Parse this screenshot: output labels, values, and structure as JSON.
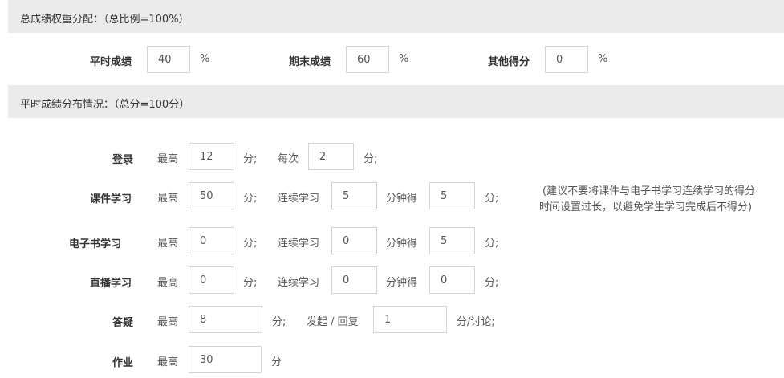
{
  "weights_section": {
    "header": "总成绩权重分配：（总比例=100%）",
    "items": [
      {
        "label": "平时成绩",
        "value": "40",
        "unit": "%"
      },
      {
        "label": "期末成绩",
        "value": "60",
        "unit": "%"
      },
      {
        "label": "其他得分",
        "value": "0",
        "unit": "%"
      }
    ]
  },
  "usual_section": {
    "header": "平时成绩分布情况：（总分=100分）",
    "login": {
      "label": "登录",
      "max_label": "最高",
      "max": "12",
      "unit": "分;",
      "each_label": "每次",
      "each": "2",
      "each_unit": "分;"
    },
    "course": {
      "label": "课件学习",
      "max_label": "最高",
      "max": "50",
      "unit": "分;",
      "cont_label": "连续学习",
      "minutes": "5",
      "min_unit": "分钟得",
      "score": "5",
      "score_unit": "分;"
    },
    "ebook": {
      "label": "电子书学习",
      "max_label": "最高",
      "max": "0",
      "unit": "分;",
      "cont_label": "连续学习",
      "minutes": "0",
      "min_unit": "分钟得",
      "score": "5",
      "score_unit": "分;"
    },
    "live": {
      "label": "直播学习",
      "max_label": "最高",
      "max": "0",
      "unit": "分;",
      "cont_label": "连续学习",
      "minutes": "0",
      "min_unit": "分钟得",
      "score": "0",
      "score_unit": "分;"
    },
    "qa": {
      "label": "答疑",
      "max_label": "最高",
      "max": "8",
      "unit": "分;",
      "post_label": "发起 / 回复",
      "per_post": "1",
      "per_unit": "分/讨论;"
    },
    "homework": {
      "label": "作业",
      "max_label": "最高",
      "max": "30",
      "unit": "分"
    },
    "note_line1": "(建议不要将课件与电子书学习连续学习的得分",
    "note_line2": "时间设置过长，以避免学生学习完成后不得分)"
  }
}
